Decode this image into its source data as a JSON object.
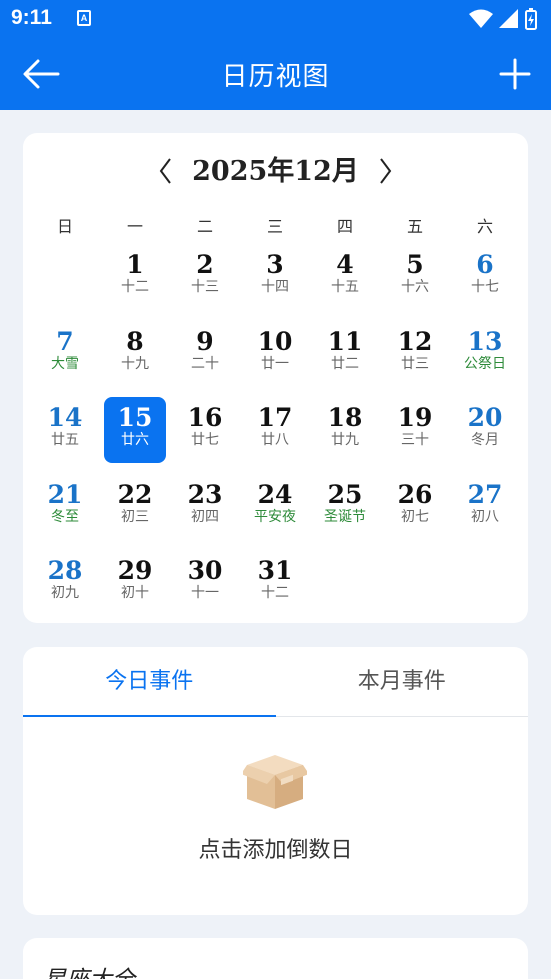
{
  "status_bar": {
    "time": "9:11",
    "notif_icon": "A"
  },
  "app_bar": {
    "title": "日历视图",
    "back_icon": "arrow-left-icon",
    "add_icon": "plus-icon"
  },
  "calendar": {
    "prev": "〈",
    "next": "〉",
    "month_title": "2025年12月",
    "weekdays": [
      "日",
      "一",
      "二",
      "三",
      "四",
      "五",
      "六"
    ],
    "days": [
      {
        "d": "1",
        "l": "十二"
      },
      {
        "d": "2",
        "l": "十三"
      },
      {
        "d": "3",
        "l": "十四"
      },
      {
        "d": "4",
        "l": "十五"
      },
      {
        "d": "5",
        "l": "十六"
      },
      {
        "d": "6",
        "l": "十七"
      },
      {
        "d": "7",
        "l": "大雪"
      },
      {
        "d": "8",
        "l": "十九"
      },
      {
        "d": "9",
        "l": "二十"
      },
      {
        "d": "10",
        "l": "廿一"
      },
      {
        "d": "11",
        "l": "廿二"
      },
      {
        "d": "12",
        "l": "廿三"
      },
      {
        "d": "13",
        "l": "公祭日"
      },
      {
        "d": "14",
        "l": "廿五"
      },
      {
        "d": "15",
        "l": "廿六"
      },
      {
        "d": "16",
        "l": "廿七"
      },
      {
        "d": "17",
        "l": "廿八"
      },
      {
        "d": "18",
        "l": "廿九"
      },
      {
        "d": "19",
        "l": "三十"
      },
      {
        "d": "20",
        "l": "冬月"
      },
      {
        "d": "21",
        "l": "冬至"
      },
      {
        "d": "22",
        "l": "初三"
      },
      {
        "d": "23",
        "l": "初四"
      },
      {
        "d": "24",
        "l": "平安夜"
      },
      {
        "d": "25",
        "l": "圣诞节"
      },
      {
        "d": "26",
        "l": "初七"
      },
      {
        "d": "27",
        "l": "初八"
      },
      {
        "d": "28",
        "l": "初九"
      },
      {
        "d": "29",
        "l": "初十"
      },
      {
        "d": "30",
        "l": "十一"
      },
      {
        "d": "31",
        "l": "十二"
      }
    ]
  },
  "events": {
    "tabs": [
      "今日事件",
      "本月事件"
    ],
    "empty_text": "点击添加倒数日",
    "empty_icon": "box-icon"
  },
  "bottom_card": {
    "title": "星座大全"
  },
  "colors": {
    "primary": "#0a73f0",
    "weekend": "#1a73c8",
    "festival": "#2e8b3a"
  }
}
